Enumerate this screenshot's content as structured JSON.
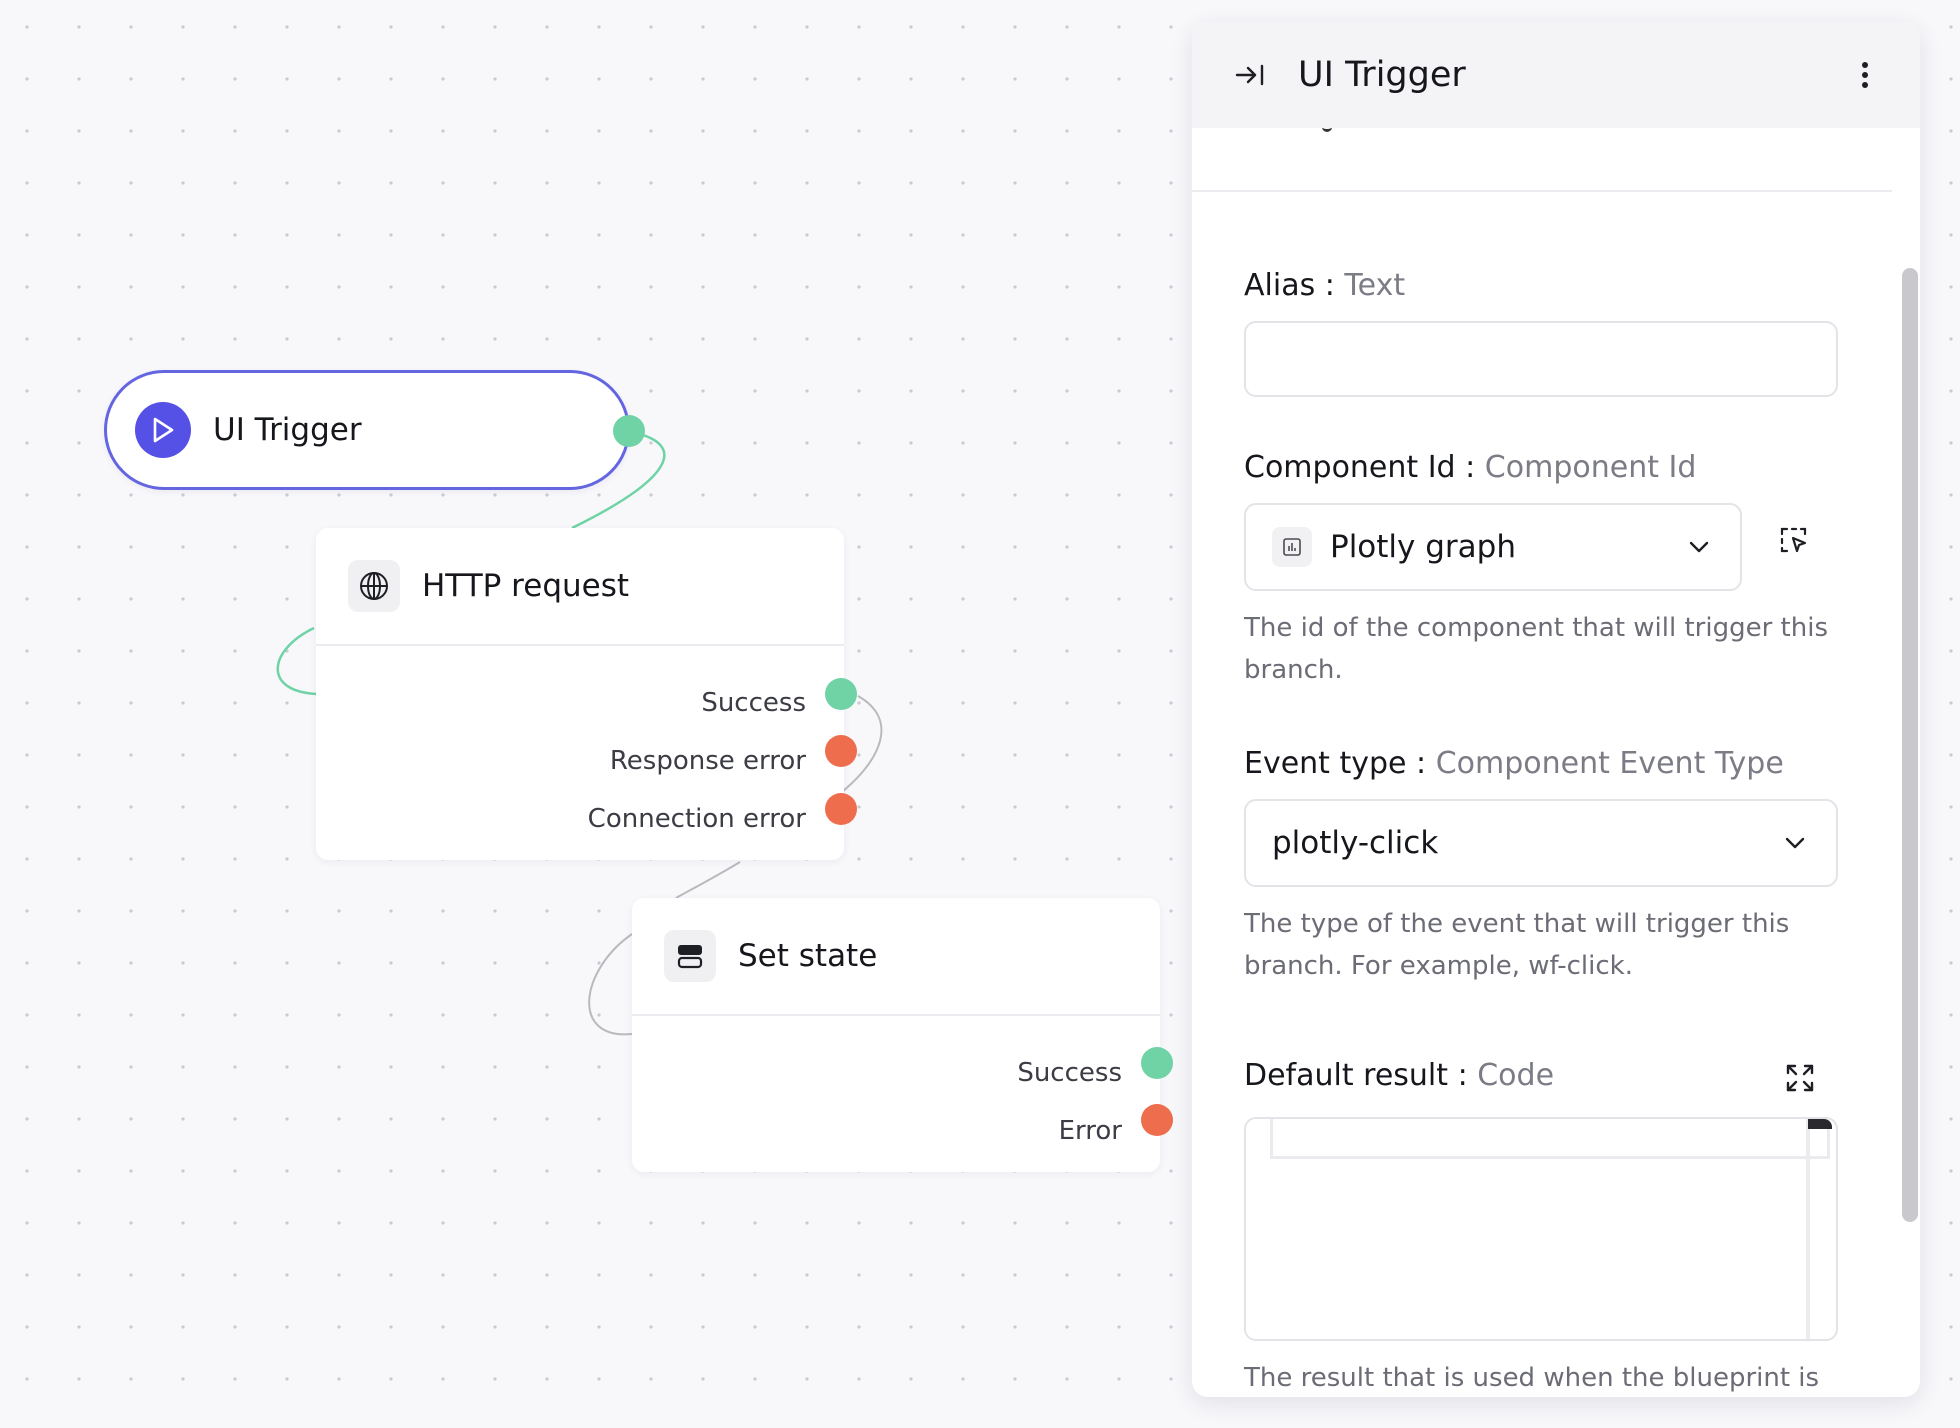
{
  "canvas": {
    "trigger_node": {
      "title": "UI Trigger",
      "icon": "play-icon"
    },
    "http_node": {
      "title": "HTTP request",
      "icon": "globe-icon",
      "outputs": [
        {
          "label": "Success",
          "status": "success"
        },
        {
          "label": "Response error",
          "status": "error"
        },
        {
          "label": "Connection error",
          "status": "error"
        }
      ]
    },
    "set_state_node": {
      "title": "Set state",
      "icon": "state-icon",
      "outputs": [
        {
          "label": "Success",
          "status": "success"
        },
        {
          "label": "Error",
          "status": "error"
        }
      ]
    }
  },
  "panel": {
    "title": "UI Trigger",
    "alias": {
      "label": "Alias",
      "type": "Text",
      "value": ""
    },
    "component_id": {
      "label": "Component Id",
      "type": "Component Id",
      "value": "Plotly graph",
      "help": "The id of the component that will trigger this branch."
    },
    "event_type": {
      "label": "Event type",
      "type": "Component Event Type",
      "value": "plotly-click",
      "help": "The type of the event that will trigger this branch. For example, wf-click."
    },
    "default_result": {
      "label": "Default result",
      "type": "Code",
      "value": "",
      "help": "The result that is used when the blueprint is"
    }
  },
  "colors": {
    "accent": "#5551e6",
    "trigger_border": "#6366e0",
    "success": "#6fd3a6",
    "error": "#ee6d4c"
  }
}
